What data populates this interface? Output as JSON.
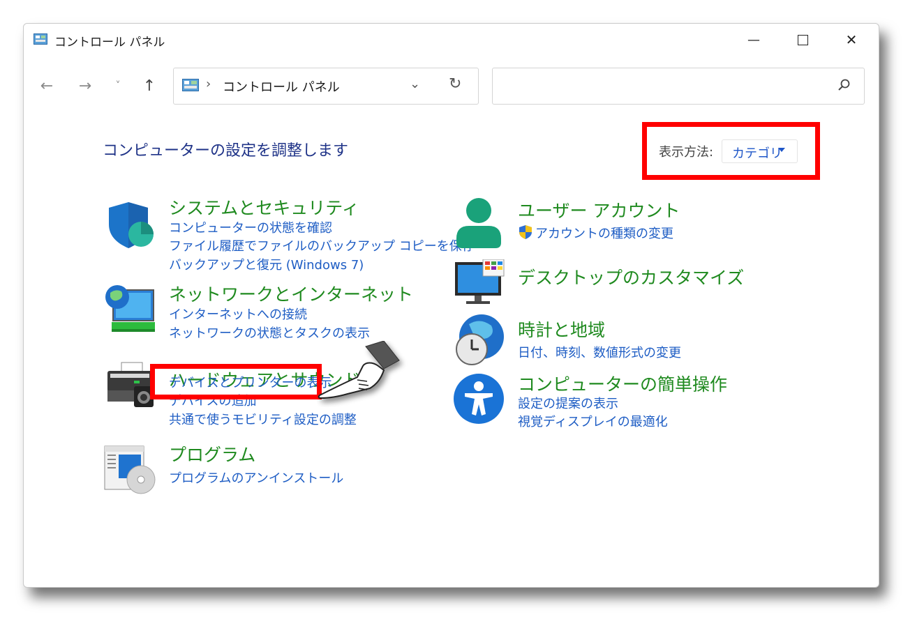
{
  "window": {
    "title": "コントロール パネル",
    "minimize_glyph": "—",
    "maximize_glyph": "☐",
    "close_glyph": "✕"
  },
  "navigation": {
    "back_glyph": "←",
    "forward_glyph": "→",
    "recent_glyph": "˅",
    "up_glyph": "↑",
    "address": {
      "separator": "›",
      "path": "コントロール パネル",
      "dropdown_glyph": "⌄",
      "refresh_glyph": "↻"
    },
    "search": {
      "placeholder": ""
    }
  },
  "main": {
    "heading": "コンピューターの設定を調整します",
    "view_by_label": "表示方法:",
    "view_by_value": "カテゴリ"
  },
  "categories_left": [
    {
      "icon": "shield-icon",
      "title": "システムとセキュリティ",
      "links": [
        "コンピューターの状態を確認",
        "ファイル履歴でファイルのバックアップ コピーを保存",
        "バックアップと復元 (Windows 7)"
      ]
    },
    {
      "icon": "network-globe-icon",
      "title": "ネットワークとインターネット",
      "links": [
        "インターネットへの接続",
        "ネットワークの状態とタスクの表示"
      ]
    },
    {
      "icon": "printer-icon",
      "title": "ハードウェアとサウンド",
      "links": [
        "デバイスとプリンターの表示",
        "デバイスの追加",
        "共通で使うモビリティ設定の調整"
      ]
    },
    {
      "icon": "program-disc-icon",
      "title": "プログラム",
      "links": [
        "プログラムのアンインストール"
      ]
    }
  ],
  "categories_right": [
    {
      "icon": "user-icon",
      "title": "ユーザー アカウント",
      "links": [
        "アカウントの種類の変更"
      ]
    },
    {
      "icon": "monitor-icon",
      "title": "デスクトップのカスタマイズ",
      "links": []
    },
    {
      "icon": "clock-globe-icon",
      "title": "時計と地域",
      "links": [
        "日付、時刻、数値形式の変更"
      ]
    },
    {
      "icon": "accessibility-icon",
      "title": "コンピューターの簡単操作",
      "links": [
        "設定の提案の表示",
        "視覚ディスプレイの最適化"
      ]
    }
  ],
  "colors": {
    "category_title": "#1f8a1f",
    "link": "#1e5dc4",
    "heading": "#1e3287",
    "highlight_box": "#ff0000"
  }
}
